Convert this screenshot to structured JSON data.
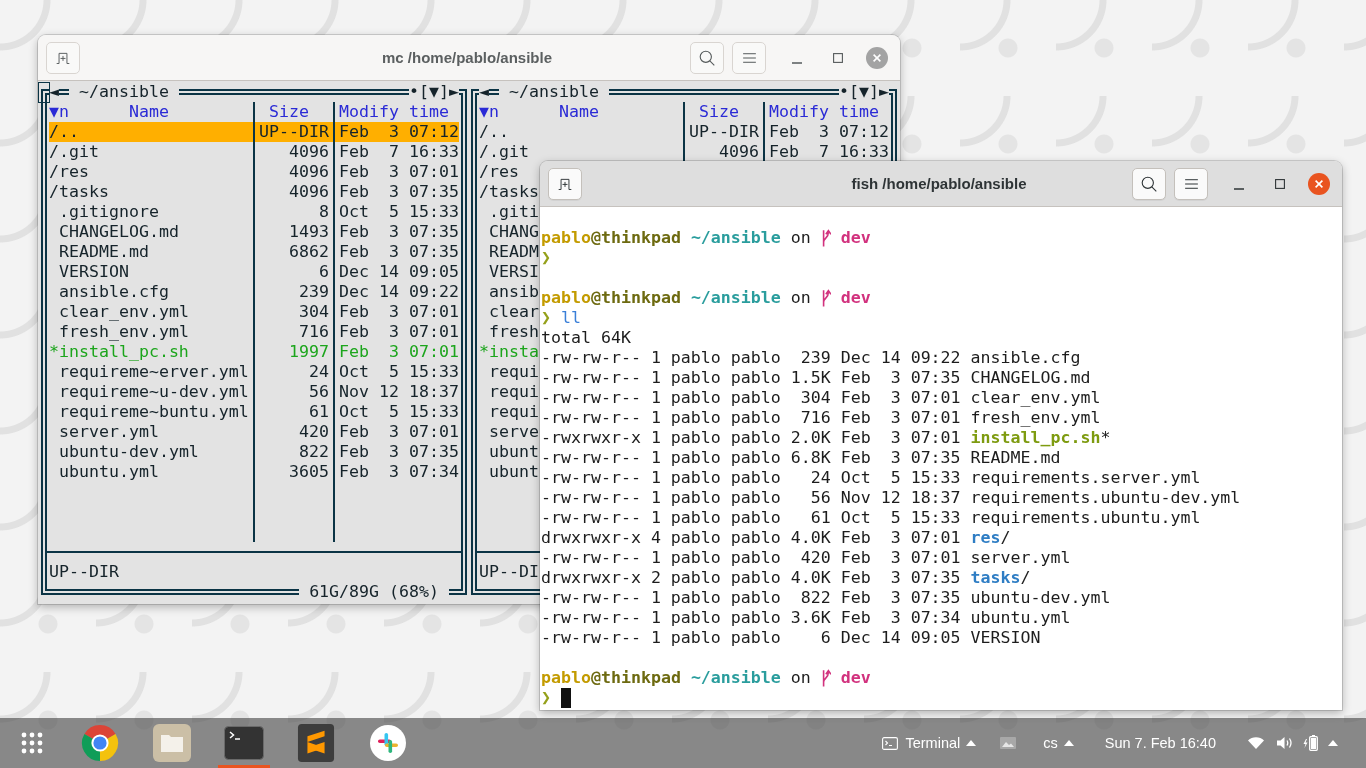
{
  "mc_window": {
    "title": "mc /home/pablo/ansible",
    "active": false,
    "cursor": true,
    "panels": [
      {
        "path": "~/ansible",
        "controls": {
          "back": "◄",
          "hidden": "•",
          "hotlist": "[▼]",
          "forward": "►"
        },
        "sort": "▼n",
        "columns": [
          "Name",
          "Size",
          "Modify time"
        ],
        "rows": [
          {
            "name": "/..",
            "size": "UP--DIR",
            "modified": "Feb  3 07:12",
            "kind": "dir",
            "selected": true
          },
          {
            "name": "/.git",
            "size": "4096",
            "modified": "Feb  7 16:33",
            "kind": "dir",
            "selected": false
          },
          {
            "name": "/res",
            "size": "4096",
            "modified": "Feb  3 07:01",
            "kind": "dir",
            "selected": false
          },
          {
            "name": "/tasks",
            "size": "4096",
            "modified": "Feb  3 07:35",
            "kind": "dir",
            "selected": false
          },
          {
            "name": ".gitignore",
            "size": "8",
            "modified": "Oct  5 15:33",
            "kind": "file",
            "selected": false
          },
          {
            "name": "CHANGELOG.md",
            "size": "1493",
            "modified": "Feb  3 07:35",
            "kind": "file",
            "selected": false
          },
          {
            "name": "README.md",
            "size": "6862",
            "modified": "Feb  3 07:35",
            "kind": "file",
            "selected": false
          },
          {
            "name": "VERSION",
            "size": "6",
            "modified": "Dec 14 09:05",
            "kind": "file",
            "selected": false
          },
          {
            "name": "ansible.cfg",
            "size": "239",
            "modified": "Dec 14 09:22",
            "kind": "file",
            "selected": false
          },
          {
            "name": "clear_env.yml",
            "size": "304",
            "modified": "Feb  3 07:01",
            "kind": "file",
            "selected": false
          },
          {
            "name": "fresh_env.yml",
            "size": "716",
            "modified": "Feb  3 07:01",
            "kind": "file",
            "selected": false
          },
          {
            "name": "*install_pc.sh",
            "size": "1997",
            "modified": "Feb  3 07:01",
            "kind": "exec",
            "selected": false
          },
          {
            "name": "requireme~erver.yml",
            "size": "24",
            "modified": "Oct  5 15:33",
            "kind": "file",
            "selected": false
          },
          {
            "name": "requireme~u-dev.yml",
            "size": "56",
            "modified": "Nov 12 18:37",
            "kind": "file",
            "selected": false
          },
          {
            "name": "requireme~buntu.yml",
            "size": "61",
            "modified": "Oct  5 15:33",
            "kind": "file",
            "selected": false
          },
          {
            "name": "server.yml",
            "size": "420",
            "modified": "Feb  3 07:01",
            "kind": "file",
            "selected": false
          },
          {
            "name": "ubuntu-dev.yml",
            "size": "822",
            "modified": "Feb  3 07:35",
            "kind": "file",
            "selected": false
          },
          {
            "name": "ubuntu.yml",
            "size": "3605",
            "modified": "Feb  3 07:34",
            "kind": "file",
            "selected": false
          }
        ],
        "status": "UP--DIR",
        "disk": "61G/89G (68%)"
      },
      {
        "path": "~/ansible",
        "controls": {
          "back": "◄",
          "hidden": "•",
          "hotlist": "[▼]",
          "forward": "►"
        },
        "sort": "▼n",
        "columns": [
          "Name",
          "Size",
          "Modify time"
        ],
        "rows": [
          {
            "name": "/..",
            "size": "UP--DIR",
            "modified": "Feb  3 07:12",
            "kind": "dir"
          },
          {
            "name": "/.git",
            "size": "4096",
            "modified": "Feb  7 16:33",
            "kind": "dir"
          },
          {
            "name": "/res",
            "kind": "dir"
          },
          {
            "name": "/tasks",
            "kind": "dir"
          },
          {
            "name": ".giti",
            "kind": "file"
          },
          {
            "name": "CHANG",
            "kind": "file"
          },
          {
            "name": "READM",
            "kind": "file"
          },
          {
            "name": "VERSI",
            "kind": "file"
          },
          {
            "name": "ansib",
            "kind": "file"
          },
          {
            "name": "clear",
            "kind": "file"
          },
          {
            "name": "fresh",
            "kind": "file"
          },
          {
            "name": "*insta",
            "kind": "exec"
          },
          {
            "name": "requi",
            "kind": "file"
          },
          {
            "name": "requi",
            "kind": "file"
          },
          {
            "name": "requi",
            "kind": "file"
          },
          {
            "name": "serve",
            "kind": "file"
          },
          {
            "name": "ubunt",
            "kind": "file"
          },
          {
            "name": "ubunt",
            "kind": "file"
          }
        ],
        "status": "UP--DI"
      }
    ]
  },
  "terminal_window": {
    "title": "fish /home/pablo/ansible",
    "active": true,
    "lines": [
      {
        "kind": "prompt",
        "user": "pablo",
        "host": "@thinkpad",
        "path": "~/ansible",
        "word": "on",
        "branch": "dev"
      },
      {
        "kind": "input",
        "symbol": "❯",
        "cursor": false
      },
      {
        "kind": "prompt",
        "user": "pablo",
        "host": "@thinkpad",
        "path": "~/ansible",
        "word": "on",
        "branch": "dev"
      },
      {
        "kind": "input",
        "symbol": "❯",
        "command": "ll",
        "cursor": false
      },
      {
        "kind": "output",
        "text": "total 64K"
      },
      {
        "kind": "file",
        "info": "-rw-rw-r-- 1 pablo pablo  239 Dec 14 09:22",
        "name": "ansible.cfg"
      },
      {
        "kind": "file",
        "info": "-rw-rw-r-- 1 pablo pablo 1.5K Feb  3 07:35",
        "name": "CHANGELOG.md"
      },
      {
        "kind": "file",
        "info": "-rw-rw-r-- 1 pablo pablo  304 Feb  3 07:01",
        "name": "clear_env.yml"
      },
      {
        "kind": "file",
        "info": "-rw-rw-r-- 1 pablo pablo  716 Feb  3 07:01",
        "name": "fresh_env.yml"
      },
      {
        "kind": "exec",
        "info": "-rwxrwxr-x 1 pablo pablo 2.0K Feb  3 07:01",
        "name": "install_pc.sh",
        "suffix": "*"
      },
      {
        "kind": "file",
        "info": "-rw-rw-r-- 1 pablo pablo 6.8K Feb  3 07:35",
        "name": "README.md"
      },
      {
        "kind": "file",
        "info": "-rw-rw-r-- 1 pablo pablo   24 Oct  5 15:33",
        "name": "requirements.server.yml"
      },
      {
        "kind": "file",
        "info": "-rw-rw-r-- 1 pablo pablo   56 Nov 12 18:37",
        "name": "requirements.ubuntu-dev.yml"
      },
      {
        "kind": "file",
        "info": "-rw-rw-r-- 1 pablo pablo   61 Oct  5 15:33",
        "name": "requirements.ubuntu.yml"
      },
      {
        "kind": "dir",
        "info": "drwxrwxr-x 4 pablo pablo 4.0K Feb  3 07:01",
        "name": "res",
        "suffix": "/"
      },
      {
        "kind": "file",
        "info": "-rw-rw-r-- 1 pablo pablo  420 Feb  3 07:01",
        "name": "server.yml"
      },
      {
        "kind": "dir",
        "info": "drwxrwxr-x 2 pablo pablo 4.0K Feb  3 07:35",
        "name": "tasks",
        "suffix": "/"
      },
      {
        "kind": "file",
        "info": "-rw-rw-r-- 1 pablo pablo  822 Feb  3 07:35",
        "name": "ubuntu-dev.yml"
      },
      {
        "kind": "file",
        "info": "-rw-rw-r-- 1 pablo pablo 3.6K Feb  3 07:34",
        "name": "ubuntu.yml"
      },
      {
        "kind": "file",
        "info": "-rw-rw-r-- 1 pablo pablo    6 Dec 14 09:05",
        "name": "VERSION"
      },
      {
        "kind": "prompt",
        "user": "pablo",
        "host": "@thinkpad",
        "path": "~/ansible",
        "word": "on",
        "branch": "dev"
      },
      {
        "kind": "input",
        "symbol": "❯",
        "cursor": true
      }
    ]
  },
  "taskbar": {
    "launchers": [
      {
        "kind": "apps",
        "active": false
      },
      {
        "kind": "browser",
        "active": false
      },
      {
        "kind": "files",
        "active": false
      },
      {
        "kind": "terminal",
        "active": true
      },
      {
        "kind": "editor",
        "active": false
      },
      {
        "kind": "chat",
        "active": false
      }
    ],
    "app_menu": "Terminal",
    "keyboard": "cs",
    "clock": "Sun 7. Feb 16:40"
  }
}
